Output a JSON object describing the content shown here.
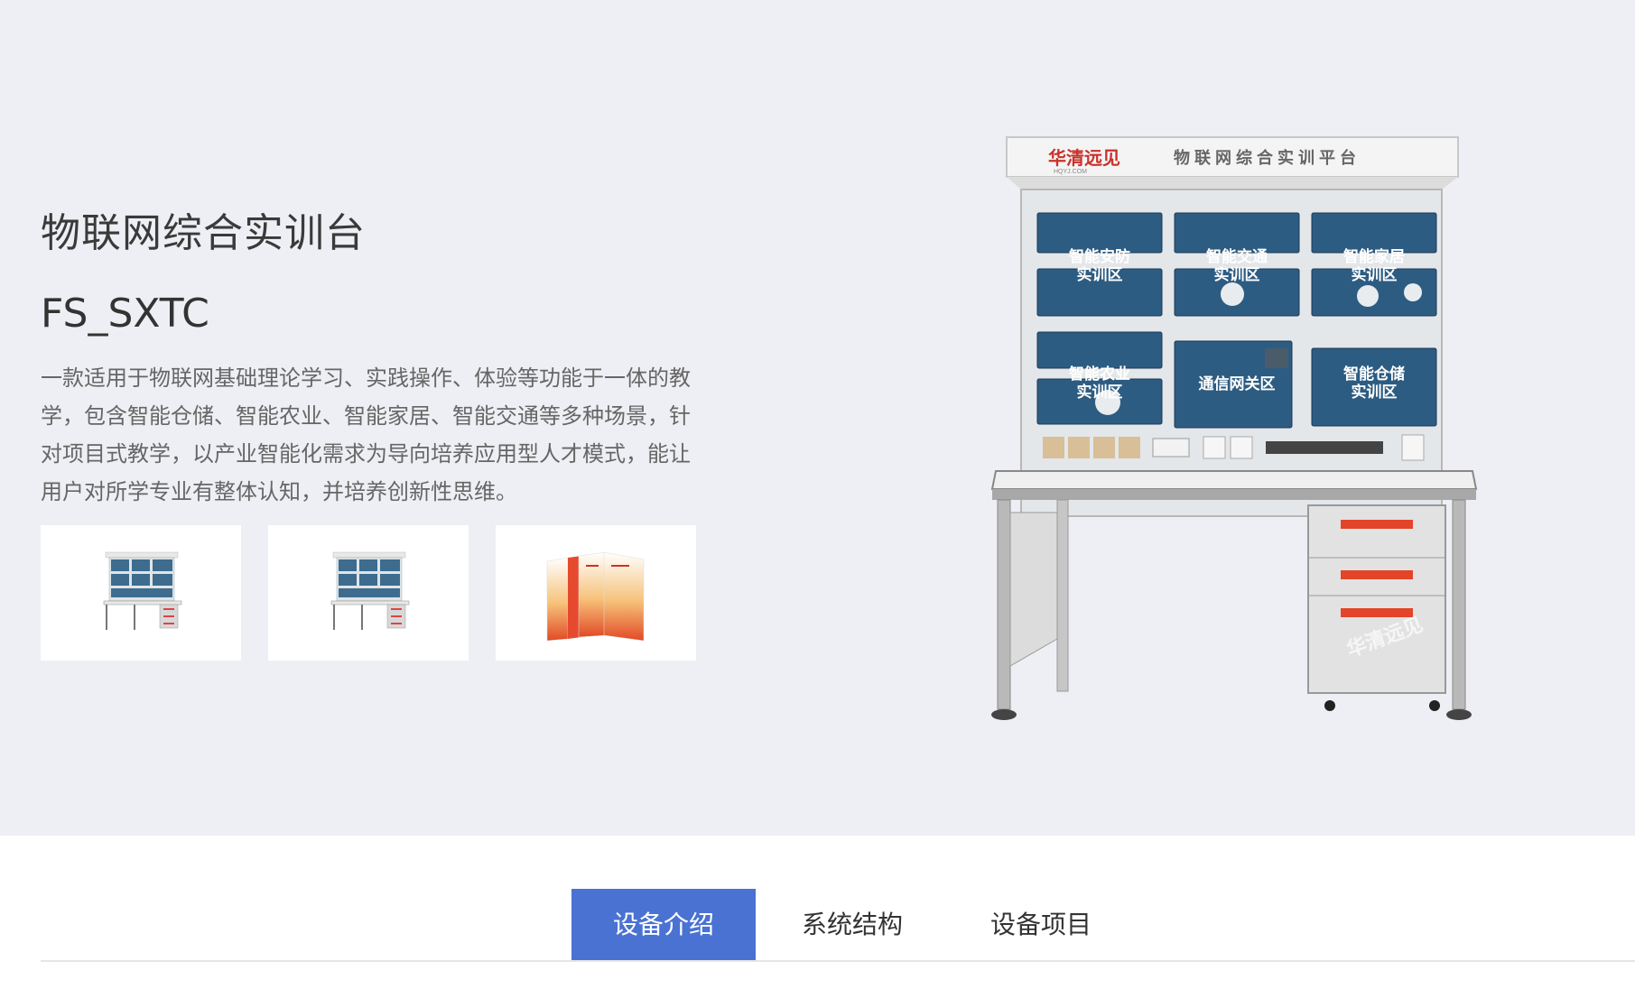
{
  "product": {
    "title": "物联网综合实训台",
    "model": "FS_SXTC",
    "description": "一款适用于物联网基础理论学习、实践操作、体验等功能于一体的教学，包含智能仓储、智能农业、智能家居、智能交通等多种场景，针对项目式教学，以产业智能化需求为导向培养应用型人才模式，能让用户对所学专业有整体认知，并培养创新性思维。"
  },
  "thumbnails": [
    {
      "name": "workbench-front"
    },
    {
      "name": "workbench-side"
    },
    {
      "name": "manual-books"
    }
  ],
  "main_image": {
    "brand": "华清远见",
    "brand_sub": "HQYJ.COM",
    "platform": "物 联 网 综 合 实 训 平 台",
    "zones": [
      "智能安防\n实训区",
      "智能交通\n实训区",
      "智能家居\n实训区",
      "智能农业\n实训区",
      "通信网关区",
      "智能仓储\n实训区"
    ],
    "watermark": "华清远见"
  },
  "tabs": [
    {
      "label": "设备介绍",
      "active": true
    },
    {
      "label": "系统结构",
      "active": false
    },
    {
      "label": "设备项目",
      "active": false
    }
  ],
  "colors": {
    "accent": "#4a72d2",
    "hero_bg": "#eeeff4",
    "brand_red": "#c8322a"
  }
}
